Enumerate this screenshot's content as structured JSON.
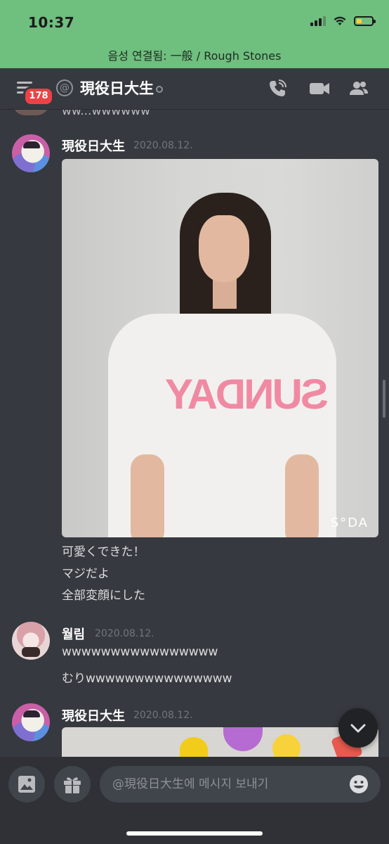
{
  "status_bar": {
    "time": "10:37",
    "battery_level": 0.3
  },
  "voice_banner": "음성 연결됨: 一般 / Rough Stones",
  "header": {
    "channel_title": "現役日大生",
    "unread_badge": "178"
  },
  "messages": [
    {
      "author": "現役日大生",
      "timestamp": "2020.08.12.",
      "image_watermark": "S°DA",
      "image_print": "SUNDAY",
      "lines": [
        "可愛くできた！",
        "マジだよ",
        "全部変顔にした"
      ]
    },
    {
      "author": "월림",
      "timestamp": "2020.08.12.",
      "lines": [
        "wwwwwwwwwwwwwwww",
        "むりwwwwwwwwwwwwwww"
      ]
    },
    {
      "author": "現役日大生",
      "timestamp": "2020.08.12."
    }
  ],
  "partial_previous_text": "ww...wwwwww",
  "input": {
    "placeholder": "@現役日大生에 메시지 보내기"
  },
  "colors": {
    "banner_green": "#6fbf7f",
    "badge_red": "#ed4245",
    "background": "#36393f"
  },
  "icons": [
    "menu-icon",
    "at-icon",
    "call-icon",
    "video-icon",
    "members-icon",
    "image-icon",
    "gift-icon",
    "emoji-icon",
    "chevron-down-icon"
  ]
}
